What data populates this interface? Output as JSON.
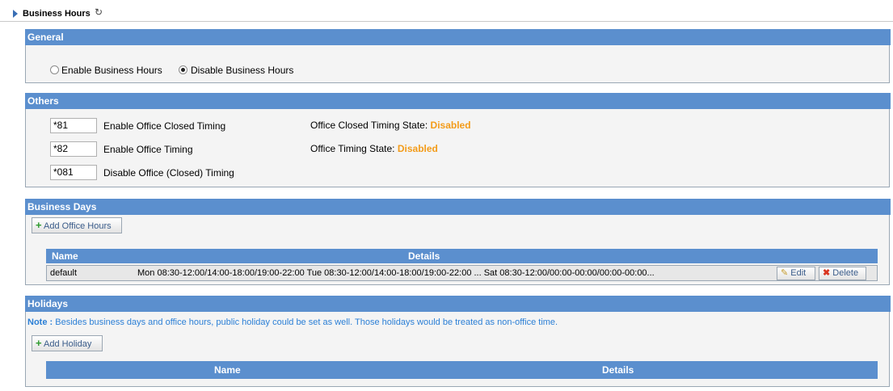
{
  "page": {
    "title": "Business Hours",
    "refresh_icon": "refresh-icon"
  },
  "general": {
    "header": "General",
    "enable_label": "Enable Business Hours",
    "disable_label": "Disable Business Hours",
    "selected": "disable"
  },
  "others": {
    "header": "Others",
    "rows": [
      {
        "code": "*81",
        "label": "Enable Office Closed Timing",
        "state_label": "Office Closed Timing State:",
        "state_value": "Disabled"
      },
      {
        "code": "*82",
        "label": "Enable Office Timing",
        "state_label": "Office Timing State:",
        "state_value": "Disabled"
      },
      {
        "code": "*081",
        "label": "Disable Office (Closed) Timing"
      }
    ]
  },
  "business_days": {
    "header": "Business Days",
    "add_button": "Add Office Hours",
    "columns": [
      "Name",
      "Details"
    ],
    "rows": [
      {
        "name": "default",
        "details": "Mon 08:30-12:00/14:00-18:00/19:00-22:00  Tue 08:30-12:00/14:00-18:00/19:00-22:00 ... Sat 08:30-12:00/00:00-00:00/00:00-00:00..."
      }
    ],
    "edit_label": "Edit",
    "delete_label": "Delete"
  },
  "holidays": {
    "header": "Holidays",
    "note_prefix": "Note :",
    "note_text": "Besides business days and office hours, public holiday could be set as well. Those holidays would be treated as non-office time.",
    "add_button": "Add Holiday",
    "columns": [
      "Name",
      "Details"
    ]
  },
  "colors": {
    "header_blue": "#5b8fce",
    "state_orange": "#f39c1a",
    "note_blue": "#2b7fd6"
  }
}
